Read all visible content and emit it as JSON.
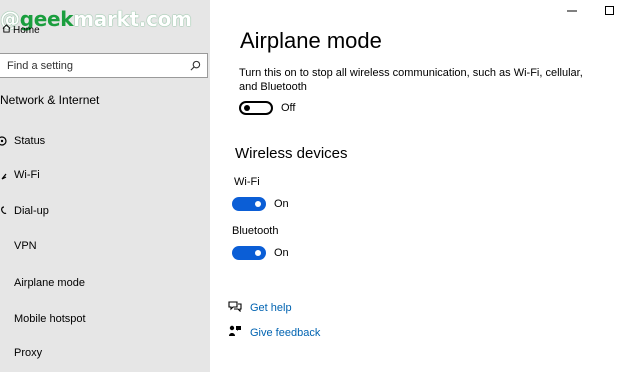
{
  "watermark": {
    "prefix": "@",
    "accent": "geek",
    "rest": "markt.com"
  },
  "sidebar": {
    "home_label": "Home",
    "search_placeholder": "Find a setting",
    "section_title": "Network & Internet",
    "items": [
      {
        "label": "Status",
        "icon": "status-icon"
      },
      {
        "label": "Wi-Fi",
        "icon": "wifi-icon"
      },
      {
        "label": "Dial-up",
        "icon": "dialup-icon"
      },
      {
        "label": "VPN",
        "icon": "vpn-icon"
      },
      {
        "label": "Airplane mode",
        "icon": "airplane-icon"
      },
      {
        "label": "Mobile hotspot",
        "icon": "hotspot-icon"
      },
      {
        "label": "Proxy",
        "icon": "proxy-icon"
      }
    ]
  },
  "main": {
    "title": "Airplane mode",
    "description": "Turn this on to stop all wireless communication, such as Wi-Fi, cellular, and Bluetooth",
    "airplane_toggle": {
      "state": "Off"
    },
    "wireless_title": "Wireless devices",
    "wifi": {
      "label": "Wi-Fi",
      "state": "On"
    },
    "bluetooth": {
      "label": "Bluetooth",
      "state": "On"
    },
    "links": {
      "help": "Get help",
      "feedback": "Give feedback"
    }
  },
  "colors": {
    "accent": "#0b5ed6",
    "link": "#0063b1",
    "sidebar_bg": "#e6e6e6",
    "watermark_green": "#1a9e3e"
  }
}
